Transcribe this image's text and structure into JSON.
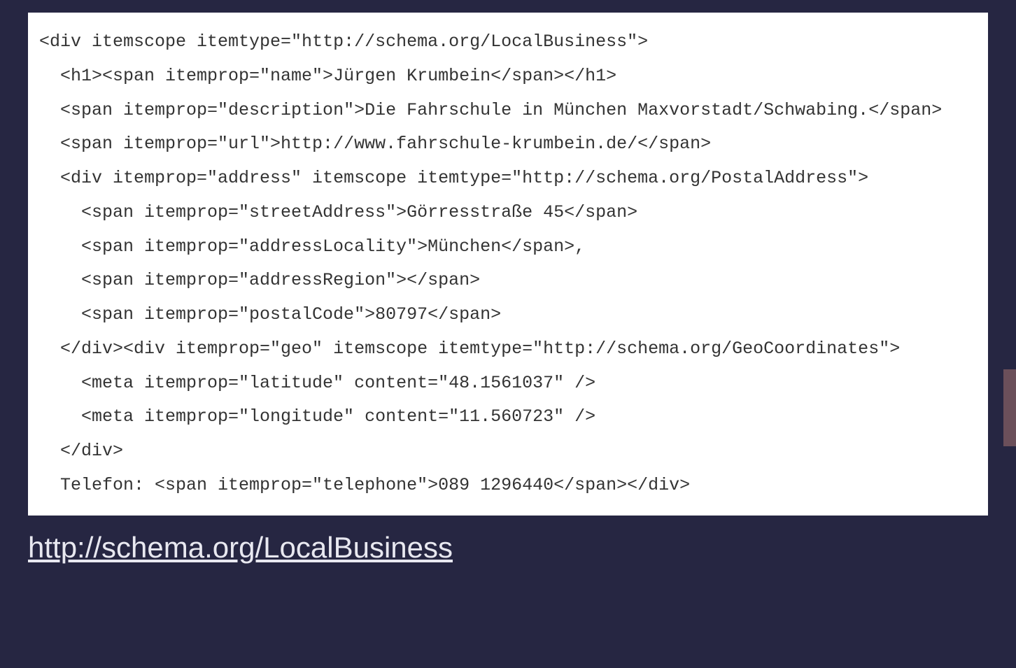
{
  "code": {
    "line1": "<div itemscope itemtype=\"http://schema.org/LocalBusiness\">",
    "line2": "<h1><span itemprop=\"name\">Jürgen Krumbein</span></h1>",
    "line3": "<span itemprop=\"description\">Die Fahrschule in München Maxvorstadt/Schwabing.</span>",
    "line4": "<span itemprop=\"url\">http://www.fahrschule-krumbein.de/</span>",
    "line5": "<div itemprop=\"address\" itemscope itemtype=\"http://schema.org/PostalAddress\">",
    "line6": "<span itemprop=\"streetAddress\">Görresstraße 45</span>",
    "line7": "<span itemprop=\"addressLocality\">München</span>,",
    "line8": "<span itemprop=\"addressRegion\"></span>",
    "line9": "<span itemprop=\"postalCode\">80797</span>",
    "line10": "</div><div itemprop=\"geo\" itemscope itemtype=\"http://schema.org/GeoCoordinates\">",
    "line11": "<meta itemprop=\"latitude\" content=\"48.1561037\" />",
    "line12": "<meta itemprop=\"longitude\" content=\"11.560723\" />",
    "line13": "</div>",
    "line14": "Telefon: <span itemprop=\"telephone\">089 1296440</span></div>"
  },
  "link_text": "http://schema.org/LocalBusiness"
}
